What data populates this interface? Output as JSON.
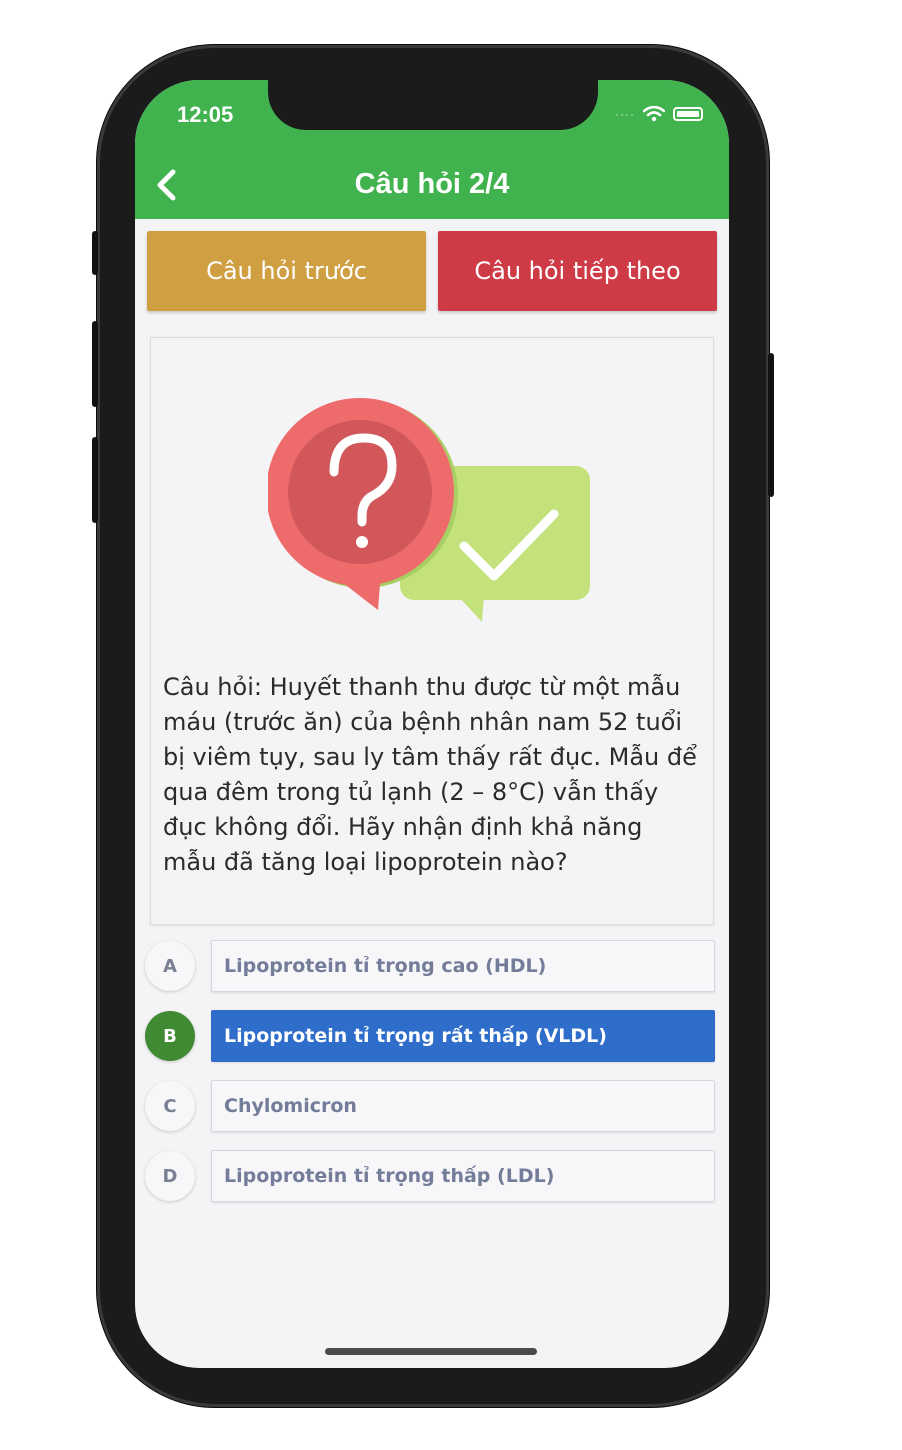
{
  "status_bar": {
    "time": "12:05"
  },
  "header": {
    "title": "Câu hỏi 2/4"
  },
  "nav": {
    "prev_label": "Câu hỏi trước",
    "next_label": "Câu hỏi tiếp theo"
  },
  "question": {
    "text": "Câu hỏi: Huyết thanh thu được từ một mẫu máu (trước ăn) của bệnh nhân nam 52 tuổi bị viêm tụy, sau ly tâm thấy rất đục. Mẫu để qua đêm trong tủ lạnh (2 – 8°C) vẫn thấy đục không đổi. Hãy nhận định khả năng mẫu đã tăng loại lipoprotein nào?"
  },
  "options": [
    {
      "letter": "A",
      "text": "Lipoprotein tỉ trọng cao (HDL)"
    },
    {
      "letter": "B",
      "text": "Lipoprotein tỉ trọng rất thấp (VLDL)"
    },
    {
      "letter": "C",
      "text": "Chylomicron"
    },
    {
      "letter": "D",
      "text": "Lipoprotein tỉ trọng thấp (LDL)"
    }
  ],
  "selected_option": "B",
  "colors": {
    "header": "#40b34f",
    "prev_button": "#cf9f42",
    "next_button": "#cf3a47",
    "selected_option": "#2f6dca",
    "selected_letter": "#3f8a33"
  }
}
